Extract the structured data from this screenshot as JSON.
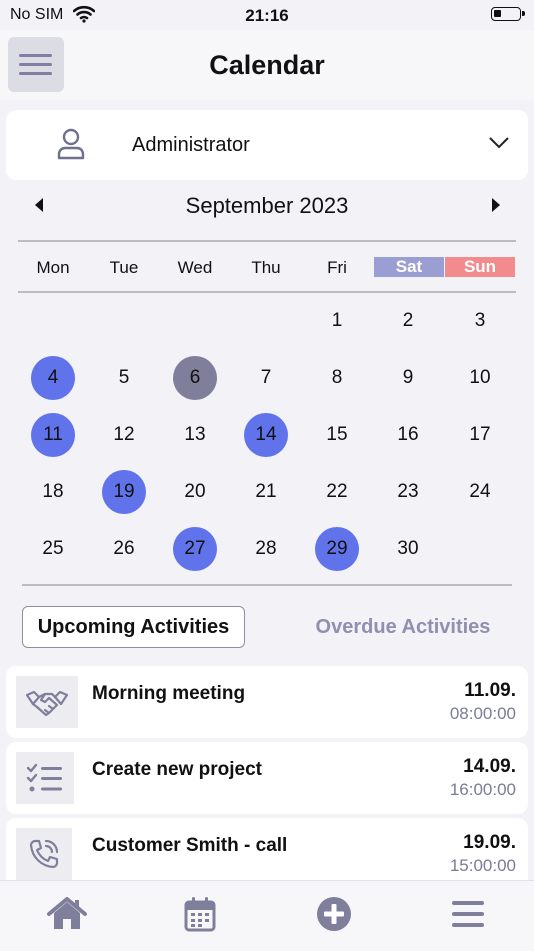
{
  "status_bar": {
    "carrier": "No SIM",
    "time": "21:16"
  },
  "header": {
    "title": "Calendar"
  },
  "user_select": {
    "selected": "Administrator"
  },
  "calendar": {
    "month_label": "September 2023",
    "weekdays": [
      "Mon",
      "Tue",
      "Wed",
      "Thu",
      "Fri",
      "Sat",
      "Sun"
    ],
    "rows": [
      [
        "",
        "",
        "",
        "",
        "1",
        "2",
        "3"
      ],
      [
        "4",
        "5",
        "6",
        "7",
        "8",
        "9",
        "10"
      ],
      [
        "11",
        "12",
        "13",
        "14",
        "15",
        "16",
        "17"
      ],
      [
        "18",
        "19",
        "20",
        "21",
        "22",
        "23",
        "24"
      ],
      [
        "25",
        "26",
        "27",
        "28",
        "29",
        "30",
        ""
      ]
    ],
    "highlighted_days": [
      "4",
      "11",
      "14",
      "19",
      "27",
      "29"
    ],
    "today": "6",
    "colors": {
      "highlight": "#6073ea",
      "today": "#7f7f9b",
      "sat": "#9b9ed3",
      "sun": "#f28b8e"
    }
  },
  "tabs": {
    "upcoming": "Upcoming Activities",
    "overdue": "Overdue Activities"
  },
  "activities": [
    {
      "icon": "handshake-icon",
      "title": "Morning meeting",
      "date": "11.09.",
      "time": "08:00:00"
    },
    {
      "icon": "checklist-icon",
      "title": "Create new project",
      "date": "14.09.",
      "time": "16:00:00"
    },
    {
      "icon": "phone-icon",
      "title": "Customer Smith - call",
      "date": "19.09.",
      "time": "15:00:00"
    }
  ],
  "bottom_nav": [
    "home-icon",
    "calendar-icon",
    "add-icon",
    "menu-icon"
  ]
}
